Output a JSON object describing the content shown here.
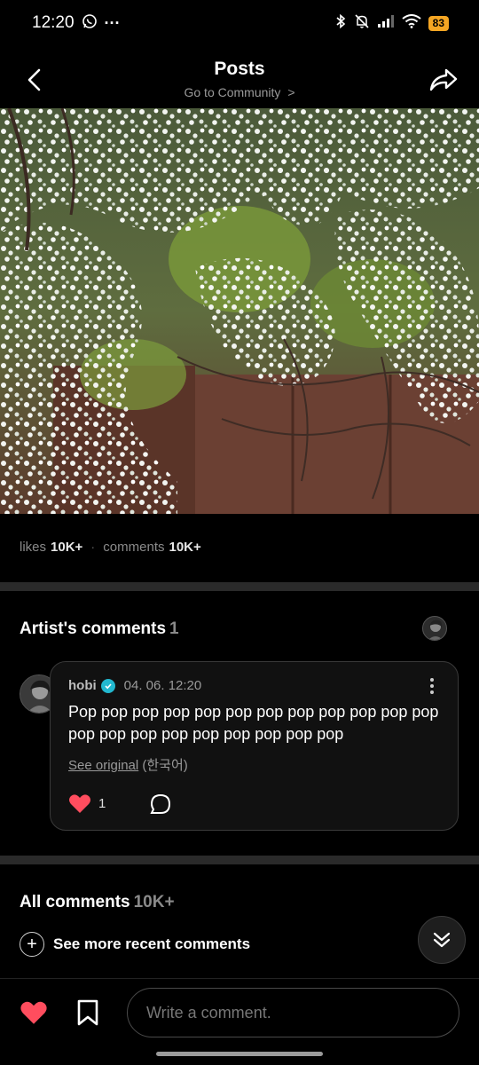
{
  "status_bar": {
    "time": "12:20",
    "dots": "···",
    "battery": "83",
    "icons": [
      "whatsapp-icon",
      "bluetooth-icon",
      "bell-muted-icon",
      "signal-icon",
      "wifi-icon",
      "battery-icon"
    ]
  },
  "header": {
    "title": "Posts",
    "subtitle": "Go to Community",
    "subtitle_chevron": ">"
  },
  "post": {
    "likes_label": "likes",
    "likes_count": "10K+",
    "comments_label": "comments",
    "comments_count": "10K+"
  },
  "artist_comments": {
    "title": "Artist's comments",
    "count": "1",
    "comment": {
      "author": "hobi",
      "date": "04. 06. 12:20",
      "text": "Pop pop pop pop pop pop pop pop pop pop pop pop pop pop pop pop pop pop pop pop pop",
      "see_original": "See original",
      "original_lang": "(한국어)",
      "like_count": "1"
    }
  },
  "all_comments": {
    "title": "All comments",
    "count": "10K+",
    "see_more": "See more recent comments",
    "see_more_icon": "+"
  },
  "bottom_bar": {
    "input_placeholder": "Write a comment."
  },
  "colors": {
    "like_red": "#ff4d5e",
    "verified": "#22b8cf",
    "battery": "#f5a623"
  }
}
